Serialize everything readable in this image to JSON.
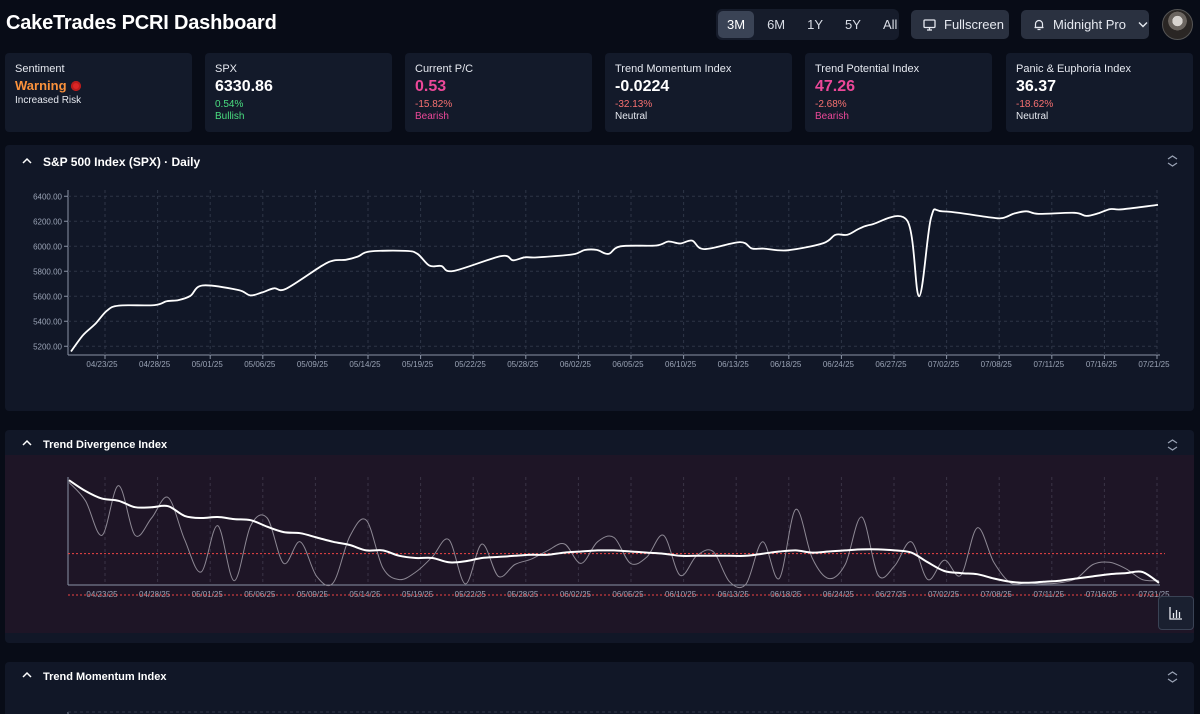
{
  "app": {
    "title": "CakeTrades PCRI Dashboard"
  },
  "ranges": [
    "3M",
    "6M",
    "1Y",
    "5Y",
    "All"
  ],
  "active_range": "3M",
  "toolbar": {
    "fullscreen_label": "Fullscreen",
    "theme_label": "Midnight Pro"
  },
  "cards": {
    "sentiment": {
      "label": "Sentiment",
      "value": "Warning",
      "detail": "Increased Risk"
    },
    "spx": {
      "label": "SPX",
      "value": "6330.86",
      "change": "0.54%",
      "signal": "Bullish"
    },
    "pc": {
      "label": "Current P/C",
      "value": "0.53",
      "change": "-15.82%",
      "signal": "Bearish"
    },
    "tmi": {
      "label": "Trend Momentum Index",
      "value": "-0.0224",
      "change": "-32.13%",
      "signal": "Neutral"
    },
    "tpi": {
      "label": "Trend Potential Index",
      "value": "47.26",
      "change": "-2.68%",
      "signal": "Bearish"
    },
    "pei": {
      "label": "Panic & Euphoria Index",
      "value": "36.37",
      "change": "-18.62%",
      "signal": "Neutral"
    }
  },
  "panels": {
    "spx": {
      "title": "S&P 500 Index (SPX) · Daily"
    },
    "tdi": {
      "title": "Trend Divergence Index"
    },
    "tmi": {
      "title": "Trend Momentum Index"
    }
  },
  "icons": {
    "chevron": "chevron-up-icon",
    "expand": "expand-icon",
    "monitor": "monitor-icon",
    "bell": "bell-icon",
    "chart_settings": "chart-settings-icon"
  },
  "colors": {
    "background": "#080c17",
    "panel": "#111727",
    "pink": "#ec4899",
    "orange": "#fb923c",
    "green": "#4ade80",
    "red_line": "#ef4444"
  },
  "chart_data": [
    {
      "type": "line",
      "title": "S&P 500 Index (SPX) · Daily",
      "x_tick_labels": [
        "04/23/25",
        "04/28/25",
        "05/01/25",
        "05/06/25",
        "05/09/25",
        "05/14/25",
        "05/19/25",
        "05/22/25",
        "05/28/25",
        "06/02/25",
        "06/05/25",
        "06/10/25",
        "06/13/25",
        "06/18/25",
        "06/24/25",
        "06/27/25",
        "07/02/25",
        "07/08/25",
        "07/11/25",
        "07/16/25",
        "07/21/25"
      ],
      "y_tick_labels": [
        "5200.00",
        "5400.00",
        "5600.00",
        "5800.00",
        "6000.00",
        "6200.00",
        "6400.00"
      ],
      "ylim": [
        5130,
        6450
      ],
      "grid": true,
      "series": [
        {
          "x": [
            "04/21/25",
            "04/22/25",
            "04/23/25",
            "04/24/25",
            "04/25/25",
            "04/28/25",
            "04/29/25",
            "04/30/25",
            "05/01/25",
            "05/02/25",
            "05/05/25",
            "05/06/25",
            "05/07/25",
            "05/08/25",
            "05/09/25",
            "05/12/25",
            "05/13/25",
            "05/14/25",
            "05/15/25",
            "05/16/25",
            "05/19/25",
            "05/20/25",
            "05/21/25",
            "05/22/25",
            "05/23/25",
            "05/27/25",
            "05/28/25",
            "05/29/25",
            "05/30/25",
            "06/02/25",
            "06/03/25",
            "06/04/25",
            "06/05/25",
            "06/06/25",
            "06/09/25",
            "06/10/25",
            "06/11/25",
            "06/12/25",
            "06/13/25",
            "06/16/25",
            "06/17/25",
            "06/18/25",
            "06/20/25",
            "06/23/25",
            "06/24/25",
            "06/25/25",
            "06/26/25",
            "06/27/25",
            "06/30/25",
            "07/01/25",
            "07/02/25",
            "07/03/25",
            "07/07/25",
            "07/08/25",
            "07/09/25",
            "07/10/25",
            "07/11/25",
            "07/14/25",
            "07/15/25",
            "07/16/25",
            "07/17/25",
            "07/18/25",
            "07/21/25"
          ],
          "values": [
            5158,
            5288,
            5376,
            5484,
            5525,
            5529,
            5560,
            5569,
            5604,
            5686,
            5650,
            5607,
            5631,
            5664,
            5660,
            5844,
            5886,
            5892,
            5917,
            5958,
            5963,
            5940,
            5845,
            5842,
            5802,
            5921,
            5888,
            5912,
            5911,
            5935,
            5970,
            5971,
            5939,
            6000,
            6006,
            6038,
            6022,
            6045,
            5977,
            6033,
            5982,
            5981,
            5968,
            6025,
            6092,
            6092,
            6141,
            6173,
            6205,
            5600,
            6227,
            6279,
            6230,
            6226,
            6263,
            6280,
            6259,
            6268,
            6243,
            6264,
            6297,
            6296,
            6331
          ]
        }
      ]
    },
    {
      "type": "line",
      "title": "Trend Divergence Index",
      "x_tick_labels": [
        "04/23/25",
        "04/28/25",
        "05/01/25",
        "05/06/25",
        "05/09/25",
        "05/14/25",
        "05/19/25",
        "05/22/25",
        "05/28/25",
        "06/02/25",
        "06/05/25",
        "06/10/25",
        "06/13/25",
        "06/18/25",
        "06/24/25",
        "06/27/25",
        "07/02/25",
        "07/08/25",
        "07/11/25",
        "07/16/25",
        "07/21/25"
      ],
      "ylim": [
        0,
        1
      ],
      "reference_line": 0.29,
      "series": [
        {
          "values": [
            0.97,
            0.87,
            0.8,
            0.78,
            0.72,
            0.72,
            0.73,
            0.64,
            0.62,
            0.63,
            0.61,
            0.6,
            0.54,
            0.49,
            0.48,
            0.44,
            0.4,
            0.37,
            0.32,
            0.32,
            0.27,
            0.25,
            0.25,
            0.21,
            0.22,
            0.25,
            0.26,
            0.27,
            0.28,
            0.28,
            0.3,
            0.31,
            0.32,
            0.32,
            0.31,
            0.3,
            0.29,
            0.27,
            0.27,
            0.27,
            0.27,
            0.27,
            0.29,
            0.31,
            0.32,
            0.3,
            0.31,
            0.32,
            0.33,
            0.33,
            0.32,
            0.3,
            0.21,
            0.13,
            0.11,
            0.1,
            0.06,
            0.03,
            0.02,
            0.03,
            0.04,
            0.06,
            0.08,
            0.1,
            0.11,
            0.12,
            0.02
          ]
        },
        {
          "values": [
            0.95,
            0.78,
            0.46,
            0.92,
            0.46,
            0.62,
            0.81,
            0.42,
            0.12,
            0.55,
            0.04,
            0.55,
            0.62,
            0.2,
            0.4,
            0.08,
            0.02,
            0.45,
            0.6,
            0.16,
            0.05,
            0.12,
            0.26,
            0.42,
            0.01,
            0.38,
            0.08,
            0.19,
            0.24,
            0.32,
            0.38,
            0.2,
            0.4,
            0.44,
            0.2,
            0.26,
            0.46,
            0.09,
            0.27,
            0.31,
            0.03,
            0.01,
            0.4,
            0.06,
            0.7,
            0.25,
            0.06,
            0.19,
            0.63,
            0.09,
            0.18,
            0.4,
            0.05,
            0.23,
            0.09,
            0.53,
            0.21,
            0.02,
            0.02,
            0.01,
            0.02,
            0.06,
            0.19,
            0.21,
            0.15,
            0.05,
            0.04
          ]
        }
      ]
    }
  ]
}
